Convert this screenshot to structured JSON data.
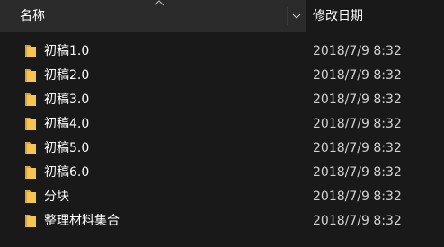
{
  "header": {
    "name_label": "名称",
    "date_label": "修改日期"
  },
  "files": [
    {
      "name": "初稿1.0",
      "date": "2018/7/9 8:32",
      "icon": "folder-icon"
    },
    {
      "name": "初稿2.0",
      "date": "2018/7/9 8:32",
      "icon": "folder-icon"
    },
    {
      "name": "初稿3.0",
      "date": "2018/7/9 8:32",
      "icon": "folder-icon"
    },
    {
      "name": "初稿4.0",
      "date": "2018/7/9 8:32",
      "icon": "folder-icon"
    },
    {
      "name": "初稿5.0",
      "date": "2018/7/9 8:32",
      "icon": "folder-icon"
    },
    {
      "name": "初稿6.0",
      "date": "2018/7/9 8:32",
      "icon": "folder-icon"
    },
    {
      "name": "分块",
      "date": "2018/7/9 8:32",
      "icon": "folder-icon"
    },
    {
      "name": "整理材料集合",
      "date": "2018/7/9 8:32",
      "icon": "folder-icon"
    }
  ],
  "colors": {
    "background": "#191919",
    "header_active": "#2b2b2b",
    "folder": "#f5c451"
  }
}
